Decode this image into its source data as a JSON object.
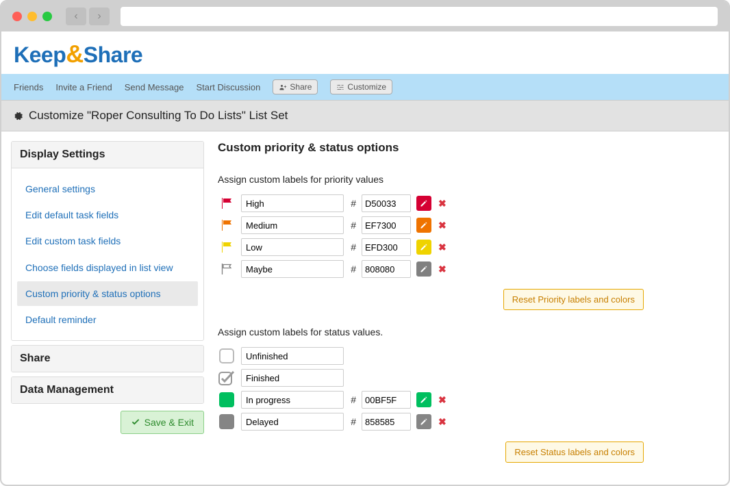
{
  "logo": {
    "part1": "Keep",
    "amp": "&",
    "part2": "Share"
  },
  "topnav": {
    "friends": "Friends",
    "invite": "Invite a Friend",
    "send": "Send Message",
    "discuss": "Start Discussion",
    "share": "Share",
    "customize": "Customize"
  },
  "page_header": "Customize \"Roper Consulting To Do Lists\" List Set",
  "sidebar": {
    "display_settings": "Display Settings",
    "share": "Share",
    "data_mgmt": "Data Management",
    "items": {
      "general": "General settings",
      "default_fields": "Edit default task fields",
      "custom_fields": "Edit custom task fields",
      "list_view": "Choose fields displayed in list view",
      "priority_status": "Custom priority & status options",
      "reminder": "Default reminder"
    },
    "save_exit": "Save & Exit"
  },
  "main": {
    "title": "Custom priority & status options",
    "priority_heading": "Assign custom labels for priority values",
    "priority": [
      {
        "label": "High",
        "color": "D50033"
      },
      {
        "label": "Medium",
        "color": "EF7300"
      },
      {
        "label": "Low",
        "color": "EFD300"
      },
      {
        "label": "Maybe",
        "color": "808080"
      }
    ],
    "reset_priority": "Reset Priority labels and colors",
    "status_heading": "Assign custom labels for status values.",
    "status": [
      {
        "label": "Unfinished",
        "type": "empty",
        "color": ""
      },
      {
        "label": "Finished",
        "type": "check",
        "color": ""
      },
      {
        "label": "In progress",
        "type": "filled",
        "color": "00BF5F"
      },
      {
        "label": "Delayed",
        "type": "filled",
        "color": "858585"
      }
    ],
    "reset_status": "Reset Status labels and colors"
  },
  "colors": {
    "flag_high": "#D50033",
    "flag_medium": "#EF7300",
    "flag_low": "#EFD300",
    "flag_maybe_outline": "#808080",
    "status_inprogress": "#00BF5F",
    "status_delayed": "#858585"
  }
}
